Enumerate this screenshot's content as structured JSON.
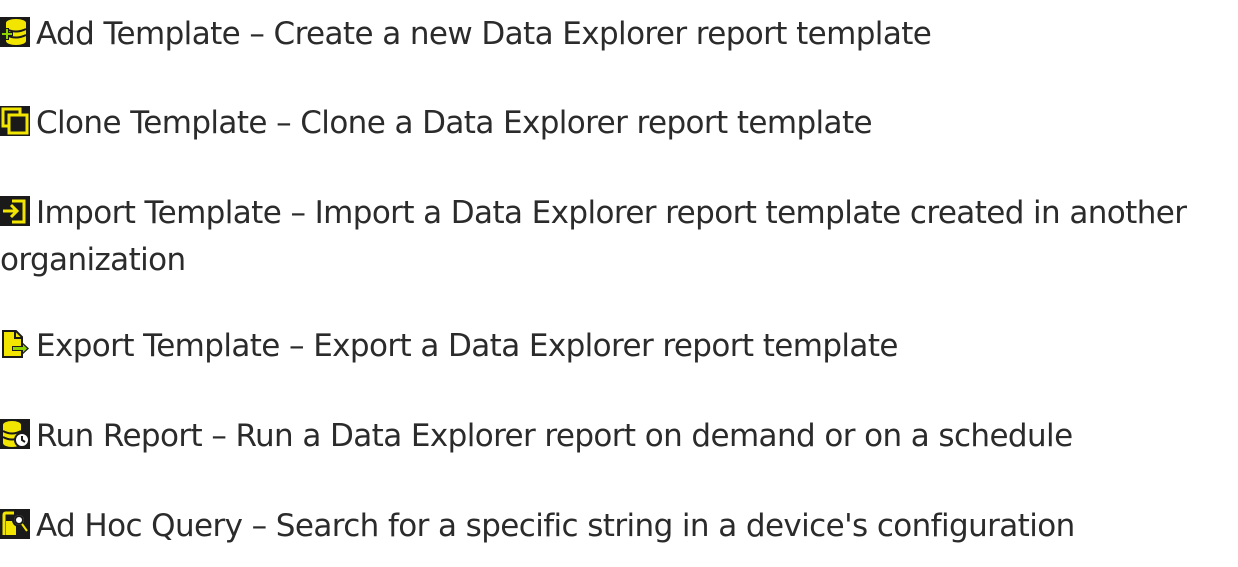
{
  "items": [
    {
      "icon": "database-add-icon",
      "text": "Add Template – Create a new Data Explorer report template"
    },
    {
      "icon": "clone-icon",
      "text": "Clone Template – Clone a Data Explorer report template"
    },
    {
      "icon": "import-icon",
      "text": "Import Template – Import a Data Explorer report template created in another organization"
    },
    {
      "icon": "export-icon",
      "text": "Export Template – Export a Data Explorer report template"
    },
    {
      "icon": "run-report-icon",
      "text": "Run Report – Run a Data Explorer report on demand or on a schedule"
    },
    {
      "icon": "ad-hoc-query-icon",
      "text": "Ad Hoc Query – Search for a specific string in a device's configuration"
    }
  ],
  "colors": {
    "icon_background": "#1a1a1a",
    "icon_accent": "#f2e600",
    "text": "#2b2b2b"
  }
}
